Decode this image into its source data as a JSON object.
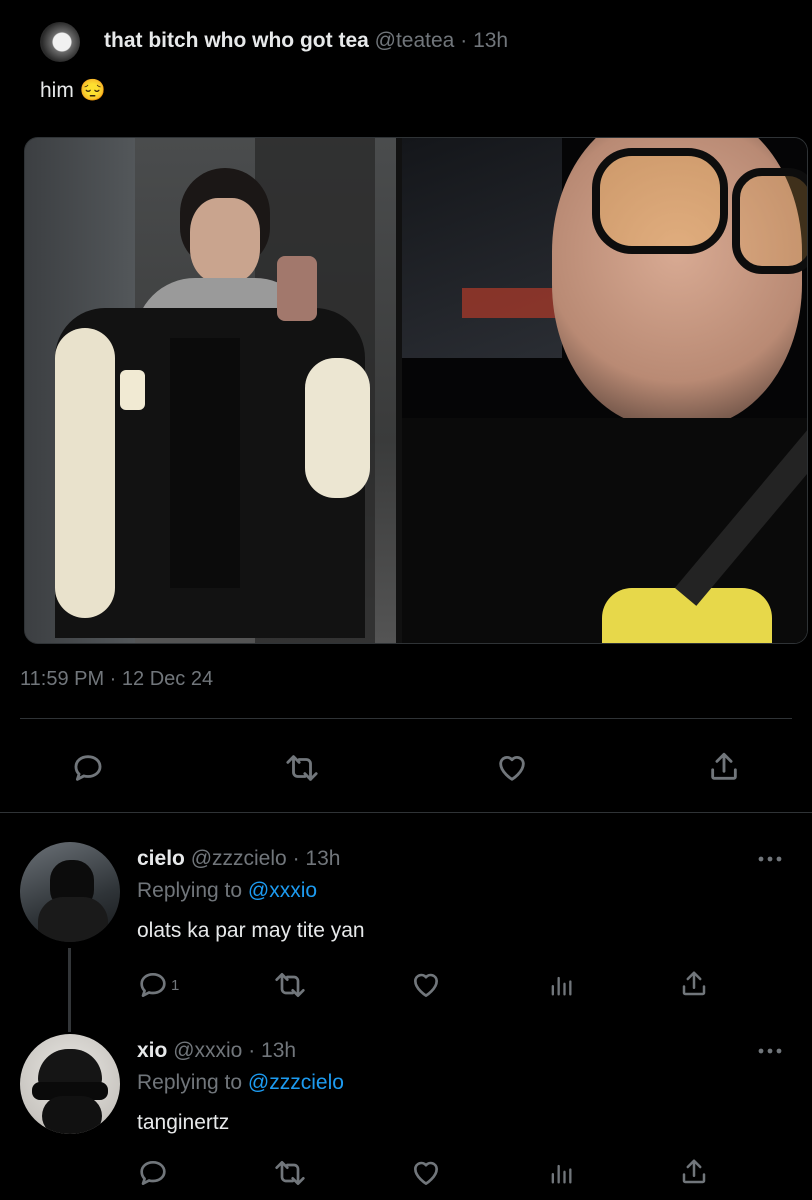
{
  "tweet": {
    "author_name": "that bitch who who got tea",
    "author_handle": "@teatea",
    "age": "13h",
    "text": "him",
    "emoji": "😔",
    "timestamp": "11:59 PM · 12 Dec 24",
    "actions": [
      "reply-icon",
      "retweet-icon",
      "like-icon",
      "share-icon"
    ]
  },
  "replies": [
    {
      "author_name": "cielo",
      "author_handle": "@zzzcielo",
      "age": "13h",
      "replying_label": "Replying to",
      "replying_to": "@xxxio",
      "text": "olats ka par may tite yan",
      "reply_count": "1"
    },
    {
      "author_name": "xio",
      "author_handle": "@xxxio",
      "age": "13h",
      "replying_label": "Replying to",
      "replying_to": "@zzzcielo",
      "text": "tanginertz",
      "reply_count": ""
    }
  ],
  "colors": {
    "background": "#000000",
    "text": "#e7e9ea",
    "muted": "#71767b",
    "link": "#1d9bf0",
    "divider": "#2f3336"
  }
}
